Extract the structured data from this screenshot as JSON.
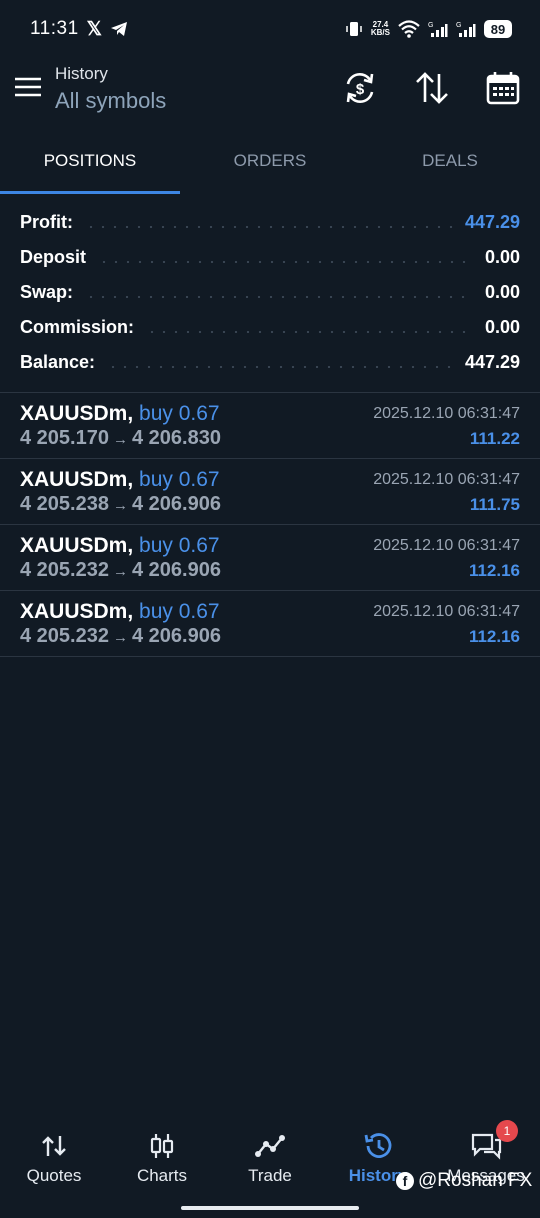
{
  "status_bar": {
    "time": "11:31",
    "net_speed_value": "27.4",
    "net_speed_unit": "KB/S",
    "battery": "89"
  },
  "header": {
    "title_small": "History",
    "title_big": "All symbols"
  },
  "tabs": [
    {
      "label": "POSITIONS",
      "active": true
    },
    {
      "label": "ORDERS",
      "active": false
    },
    {
      "label": "DEALS",
      "active": false
    }
  ],
  "summary": [
    {
      "label": "Profit:",
      "value": "447.29"
    },
    {
      "label": "Deposit",
      "value": "0.00"
    },
    {
      "label": "Swap:",
      "value": "0.00"
    },
    {
      "label": "Commission:",
      "value": "0.00"
    },
    {
      "label": "Balance:",
      "value": "447.29"
    }
  ],
  "positions": [
    {
      "symbol": "XAUUSDm,",
      "side": "buy 0.67",
      "open_price": "4 205.170",
      "arrow": "→",
      "close_price": "4 206.830",
      "time": "2025.12.10 06:31:47",
      "profit": "111.22"
    },
    {
      "symbol": "XAUUSDm,",
      "side": "buy 0.67",
      "open_price": "4 205.238",
      "arrow": "→",
      "close_price": "4 206.906",
      "time": "2025.12.10 06:31:47",
      "profit": "111.75"
    },
    {
      "symbol": "XAUUSDm,",
      "side": "buy 0.67",
      "open_price": "4 205.232",
      "arrow": "→",
      "close_price": "4 206.906",
      "time": "2025.12.10 06:31:47",
      "profit": "112.16"
    },
    {
      "symbol": "XAUUSDm,",
      "side": "buy 0.67",
      "open_price": "4 205.232",
      "arrow": "→",
      "close_price": "4 206.906",
      "time": "2025.12.10 06:31:47",
      "profit": "112.16"
    }
  ],
  "bottom_nav": [
    {
      "label": "Quotes",
      "icon": "quotes-icon"
    },
    {
      "label": "Charts",
      "icon": "candlestick-icon"
    },
    {
      "label": "Trade",
      "icon": "trend-icon"
    },
    {
      "label": "History",
      "icon": "history-icon",
      "active": true
    },
    {
      "label": "Messages",
      "icon": "messages-icon",
      "badge": "1"
    }
  ],
  "watermark": "@Roshan FX",
  "colors": {
    "accent": "#4a90e8",
    "background": "#111a24",
    "badge": "#e5484d"
  }
}
